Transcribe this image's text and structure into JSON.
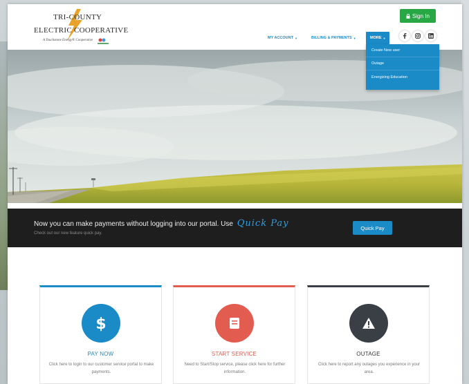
{
  "colors": {
    "brand_blue": "#1a8bc7",
    "signin_green": "#27a844",
    "pay_blue": "#1a8bc7",
    "start_red": "#e25c50",
    "outage_dark": "#3a3f46"
  },
  "logo": {
    "line1": "TRI-COUNTY",
    "line2": "ELECTRIC COOPERATIVE",
    "tagline": "A Touchstone Energy® Cooperative"
  },
  "header": {
    "signin_label": "Sign In",
    "signin_icon": "lock-icon",
    "nav": [
      {
        "label": "MY ACCOUNT"
      },
      {
        "label": "BILLING & PAYMENTS"
      },
      {
        "label": "MORE"
      }
    ],
    "social_icons": [
      "facebook-icon",
      "instagram-icon",
      "linkedin-icon"
    ]
  },
  "more_menu": {
    "items": [
      {
        "label": "Create New user"
      },
      {
        "label": "Outage"
      },
      {
        "label": "Energizing Education"
      }
    ]
  },
  "banner": {
    "headline": "Now you can make payments without logging into our portal. Use",
    "headline_highlight": "Quick Pay",
    "subtext": "Check out our new feature quick pay.",
    "button_label": "Quick Pay"
  },
  "cards": [
    {
      "title": "PAY NOW",
      "description": "Click here to login to our customer service portal to make payments.",
      "icon": "dollar-icon",
      "color": "#1a8bc7"
    },
    {
      "title": "START SERVICE",
      "description": "Need to Start/Stop service, please click here for further information.",
      "icon": "book-icon",
      "color": "#e25c50"
    },
    {
      "title": "OUTAGE",
      "description": "Click here to report any outages you experience in your area.",
      "icon": "warning-icon",
      "color": "#3a3f46"
    }
  ]
}
